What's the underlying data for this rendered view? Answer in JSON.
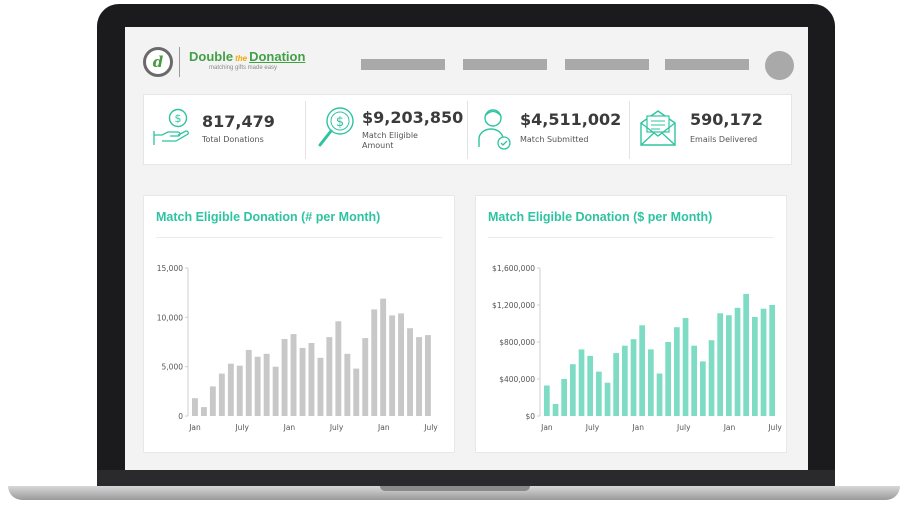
{
  "app": {
    "logo_mark": "d",
    "logo_word1": "Double",
    "logo_the": "the",
    "logo_word2": "Donation",
    "logo_tagline": "matching gifts made easy"
  },
  "nav": {
    "item_count": 4
  },
  "stats": [
    {
      "icon": "hand-coin-icon",
      "value": "817,479",
      "label": "Total Donations"
    },
    {
      "icon": "dollar-magnifier-icon",
      "value": "$9,203,850",
      "label": "Match Eligible Amount"
    },
    {
      "icon": "person-check-icon",
      "value": "$4,511,002",
      "label": "Match Submitted"
    },
    {
      "icon": "envelope-icon",
      "value": "590,172",
      "label": "Emails Delivered"
    }
  ],
  "colors": {
    "accent": "#2ec4a1",
    "bar_gray": "#c8c8c8",
    "bar_teal": "#7fdcc4",
    "logo_green": "#43a047"
  },
  "charts": [
    {
      "title": "Match Eligible Donation (# per Month)",
      "chart_data": {
        "type": "bar",
        "color": "#c8c8c8",
        "x_ticks": [
          "Jan",
          "July",
          "Jan",
          "July",
          "Jan",
          "July"
        ],
        "y_ticks": [
          "15,000",
          "10,000",
          "5,000",
          "0"
        ],
        "ylim": [
          0,
          15000
        ],
        "values": [
          1800,
          900,
          3000,
          4300,
          5300,
          5100,
          6700,
          6000,
          6300,
          5000,
          7800,
          8300,
          6900,
          7400,
          5900,
          8000,
          9600,
          6300,
          4800,
          7900,
          10800,
          11900,
          10200,
          10400,
          8900,
          8000,
          8200
        ]
      }
    },
    {
      "title": "Match Eligible Donation ($ per Month)",
      "chart_data": {
        "type": "bar",
        "color": "#7fdcc4",
        "x_ticks": [
          "Jan",
          "July",
          "Jan",
          "July",
          "Jan",
          "July"
        ],
        "y_ticks": [
          "$1,600,000",
          "$1,200,000",
          "$800,000",
          "$400,000",
          "$0"
        ],
        "ylim": [
          0,
          1600000
        ],
        "values": [
          330000,
          130000,
          400000,
          560000,
          720000,
          650000,
          480000,
          360000,
          680000,
          760000,
          830000,
          980000,
          720000,
          460000,
          800000,
          960000,
          1060000,
          760000,
          590000,
          820000,
          1110000,
          1090000,
          1170000,
          1320000,
          1070000,
          1160000,
          1200000
        ]
      }
    }
  ]
}
